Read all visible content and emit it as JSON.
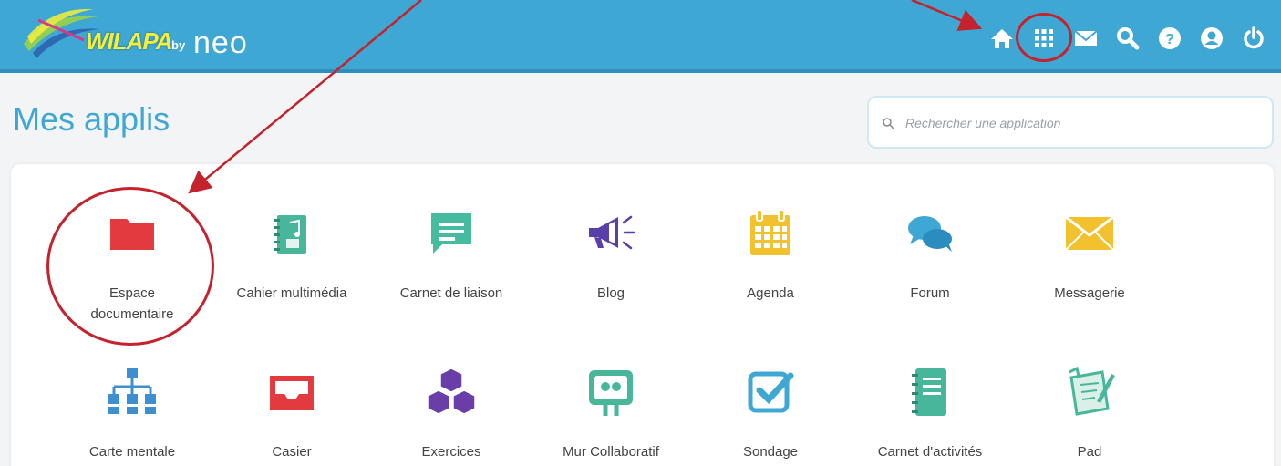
{
  "header": {
    "logo_main": "WILAPA",
    "logo_by": "by",
    "logo_neo": "neo",
    "icons": [
      "home-icon",
      "apps-grid-icon",
      "mail-icon",
      "search-icon",
      "help-icon",
      "user-icon",
      "power-icon"
    ]
  },
  "page": {
    "title": "Mes applis"
  },
  "search": {
    "placeholder": "Rechercher une application"
  },
  "apps": [
    {
      "label": "Espace documentaire",
      "icon": "folder-icon",
      "color": "#e23a3e"
    },
    {
      "label": "Cahier multimédia",
      "icon": "multimedia-notebook-icon",
      "color": "#47b69a"
    },
    {
      "label": "Carnet de liaison",
      "icon": "message-square-icon",
      "color": "#45bba0"
    },
    {
      "label": "Blog",
      "icon": "megaphone-icon",
      "color": "#5b3fa8"
    },
    {
      "label": "Agenda",
      "icon": "calendar-icon",
      "color": "#f2c12e"
    },
    {
      "label": "Forum",
      "icon": "chat-bubbles-icon",
      "color": "#3ea7d4"
    },
    {
      "label": "Messagerie",
      "icon": "envelope-icon",
      "color": "#f2c12e"
    },
    {
      "label": "Carte mentale",
      "icon": "sitemap-icon",
      "color": "#3e8fd0"
    },
    {
      "label": "Casier",
      "icon": "inbox-tray-icon",
      "color": "#e23a3e"
    },
    {
      "label": "Exercices",
      "icon": "cubes-icon",
      "color": "#6a3ea8"
    },
    {
      "label": "Mur Collaboratif",
      "icon": "collab-wall-icon",
      "color": "#47b69a"
    },
    {
      "label": "Sondage",
      "icon": "checkbox-icon",
      "color": "#3ea7d4"
    },
    {
      "label": "Carnet d'activités",
      "icon": "activity-notebook-icon",
      "color": "#47b69a"
    },
    {
      "label": "Pad",
      "icon": "pad-icon",
      "color": "#47b69a"
    }
  ],
  "annotation": {
    "color": "#c4222c"
  }
}
